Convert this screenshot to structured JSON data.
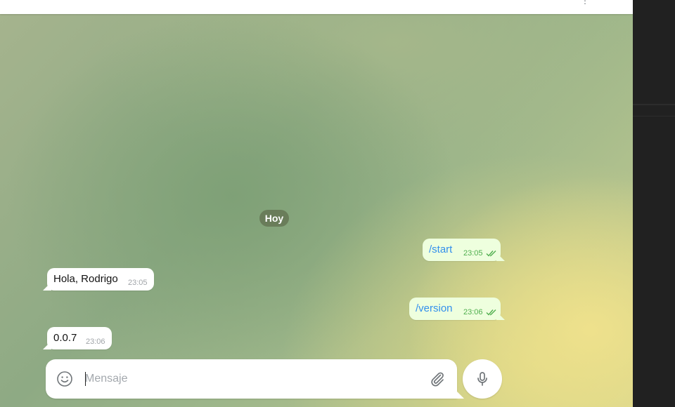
{
  "chat": {
    "date_separator": "Hoy",
    "messages": [
      {
        "direction": "out",
        "text": "/start",
        "time": "23:05",
        "status": "read"
      },
      {
        "direction": "in",
        "text": "Hola, Rodrigo",
        "time": "23:05"
      },
      {
        "direction": "out",
        "text": "/version",
        "time": "23:06",
        "status": "read"
      },
      {
        "direction": "in",
        "text": "0.0.7",
        "time": "23:06"
      }
    ]
  },
  "composer": {
    "placeholder": "Mensaje",
    "value": ""
  },
  "icons": {
    "emoji": "smiley-icon",
    "attach": "paperclip-icon",
    "voice": "microphone-icon",
    "read_status": "double-check-icon",
    "header_menu": "more-icon"
  },
  "colors": {
    "outgoing_bubble": "#eeffde",
    "incoming_bubble": "#ffffff",
    "link_text": "#3390ec",
    "read_check": "#4fae4e",
    "date_pill": "#606e4e",
    "side_panel": "#212121"
  }
}
